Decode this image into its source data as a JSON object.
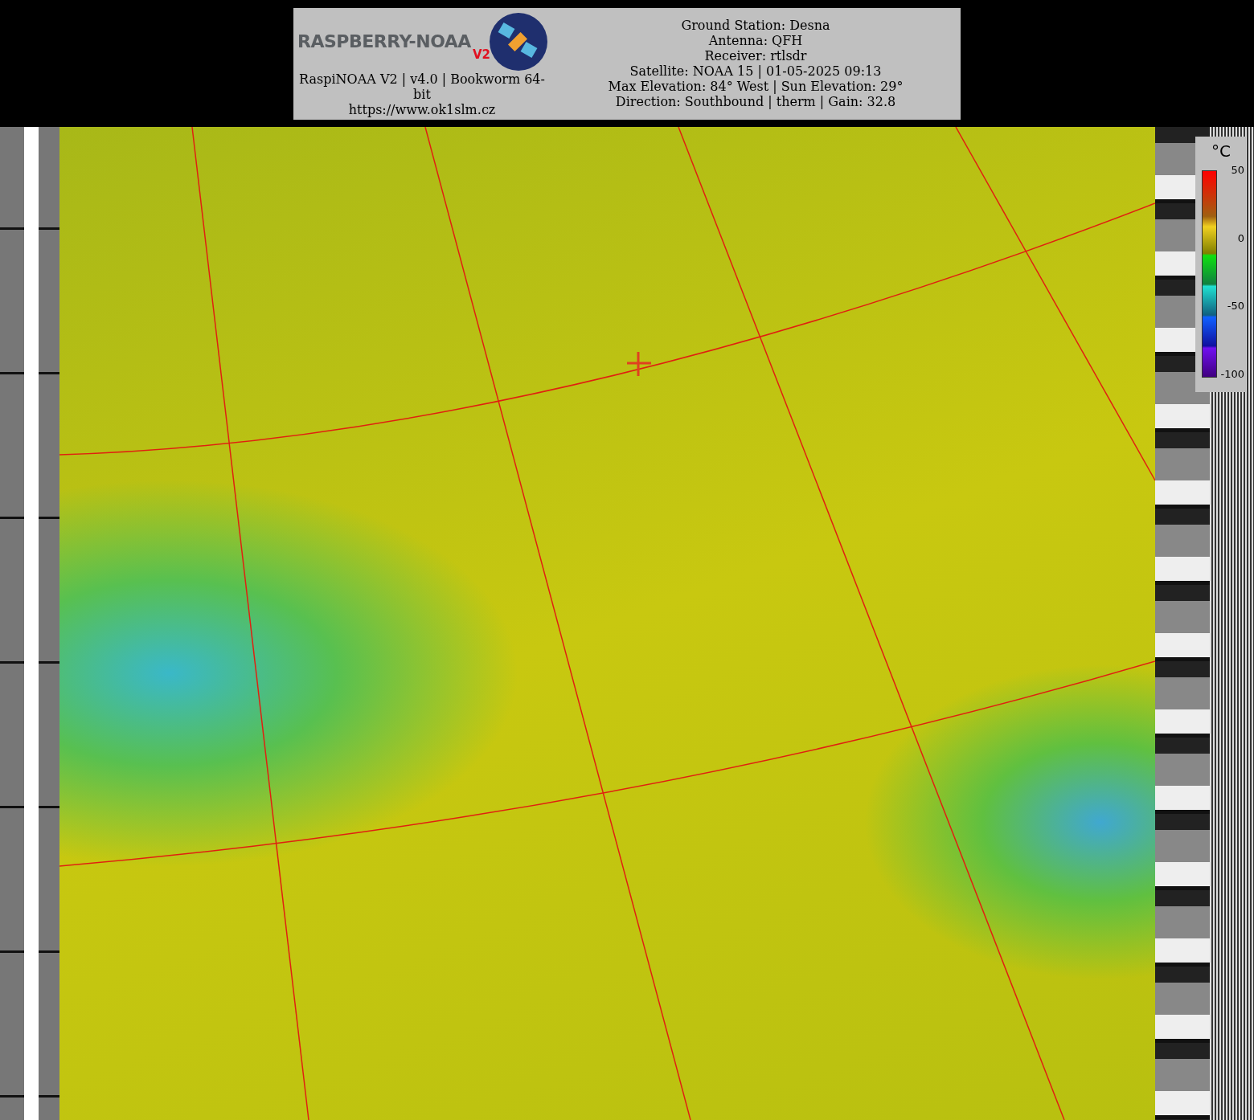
{
  "header": {
    "logo": {
      "wordmark": "RASPBERRY-NOAA",
      "badge": "V2"
    },
    "software": "RaspiNOAA V2 | v4.0 | Bookworm 64-bit",
    "website": "https://www.ok1slm.cz",
    "pass_info": [
      "Ground Station: Desna",
      "Antenna: QFH",
      "Receiver: rtlsdr",
      "Satellite: NOAA 15 | 01-05-2025 09:13",
      "Max Elevation: 84° West | Sun Elevation: 29°",
      "Direction: Southbound | therm | Gain: 32.8"
    ]
  },
  "legend": {
    "unit": "°C",
    "ticks": [
      "50",
      "0",
      "-50",
      "-100"
    ]
  }
}
